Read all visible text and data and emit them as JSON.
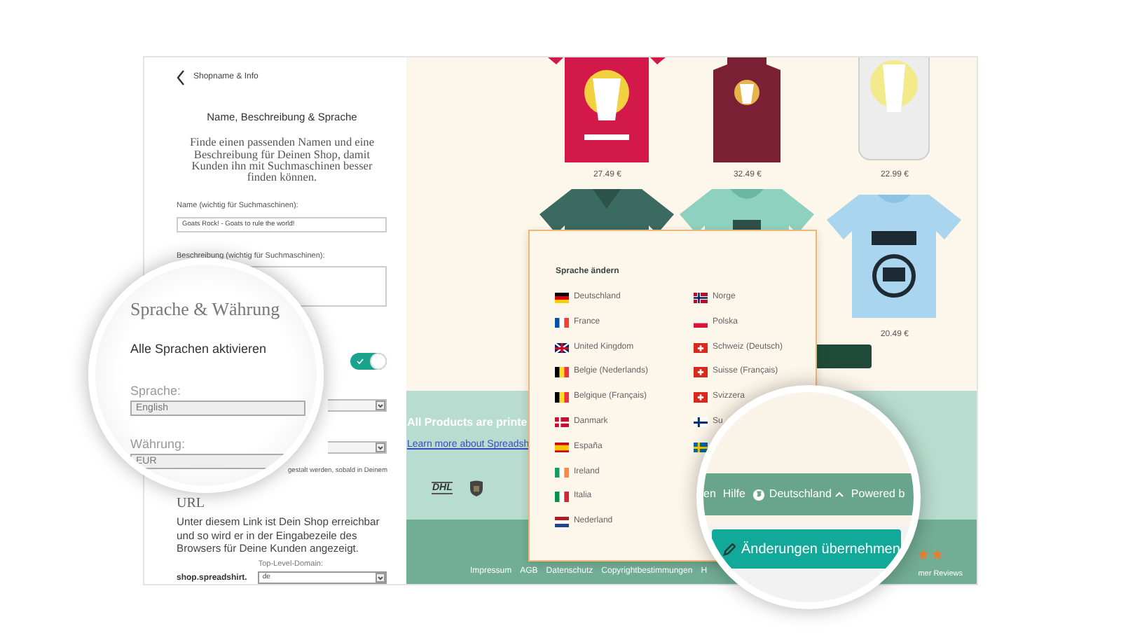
{
  "left_panel": {
    "back_link": "Shopname & Info",
    "title": "Name, Beschreibung & Sprache",
    "intro": "Finde einen passenden Namen und eine Beschreibung für Deinen Shop, damit Kunden ihn mit Suchmaschinen besser finden können.",
    "name_field": {
      "label": "Name (wichtig für Suchmaschinen):",
      "value": "Goats Rock! - Goats to rule the world!"
    },
    "description_field": {
      "label": "Beschreibung (wichtig für Suchmaschinen):"
    },
    "language_toggle": {
      "on": true
    },
    "hint": "gestalt werden, sobald in Deinem",
    "url_heading": "URL",
    "url_text": "Unter diesem Link ist Dein Shop erreichbar und so wird er in der Eingabezeile des Browsers für Deine Kunden angezeigt.",
    "domain_prefix": "shop.spreadshirt.",
    "tld_field": {
      "label": "Top-Level-Domain:",
      "value": "de"
    }
  },
  "magnifier_left": {
    "heading": "Sprache & Währung",
    "toggle_label": "Alle Sprachen aktivieren",
    "language": {
      "label": "Sprache:",
      "value": "English"
    },
    "currency": {
      "label": "Währung:",
      "value": "EUR"
    }
  },
  "products": [
    {
      "kind": "picture",
      "price": "27.49 €"
    },
    {
      "kind": "picture",
      "price": "32.49 €"
    },
    {
      "kind": "picture",
      "price": "22.99 €"
    },
    {
      "kind": "picture"
    },
    {
      "kind": "picture"
    },
    {
      "kind": "picture",
      "price": "20.49 €"
    }
  ],
  "banner": {
    "text": "All Products are printe",
    "link": "Learn more about Spreadsh",
    "logo": "DHL"
  },
  "footer": {
    "links": [
      "Impressum",
      "AGB",
      "Datenschutz",
      "Copyrightbestimmungen",
      "H"
    ],
    "reviews": "mer Reviews"
  },
  "language_menu": {
    "title": "Sprache ändern",
    "columns": [
      [
        {
          "label": "Deutschland",
          "kind": "de"
        },
        {
          "label": "France",
          "kind": "fr"
        },
        {
          "label": "United Kingdom",
          "kind": "gb"
        },
        {
          "label": "Belgie (Nederlands)",
          "kind": "be"
        },
        {
          "label": "Belgique (Français)",
          "kind": "be"
        },
        {
          "label": "Danmark",
          "kind": "dk"
        },
        {
          "label": "España",
          "kind": "es"
        },
        {
          "label": "Ireland",
          "kind": "ie"
        },
        {
          "label": "Italia",
          "kind": "it"
        },
        {
          "label": "Nederland",
          "kind": "nl"
        }
      ],
      [
        {
          "label": "Norge",
          "kind": "no"
        },
        {
          "label": "Polska",
          "kind": "pl"
        },
        {
          "label": "Schweiz (Deutsch)",
          "kind": "ch"
        },
        {
          "label": "Suisse (Français)",
          "kind": "ch"
        },
        {
          "label": "Svizzera",
          "kind": "ch"
        },
        {
          "label": "Su",
          "kind": "fi"
        },
        {
          "kind": "se"
        }
      ]
    ]
  },
  "magnifier_right": {
    "nav": [
      "en",
      "Hilfe"
    ],
    "country": "Deutschland",
    "powered": "Powered b",
    "button": "Änderungen übernehmen"
  }
}
